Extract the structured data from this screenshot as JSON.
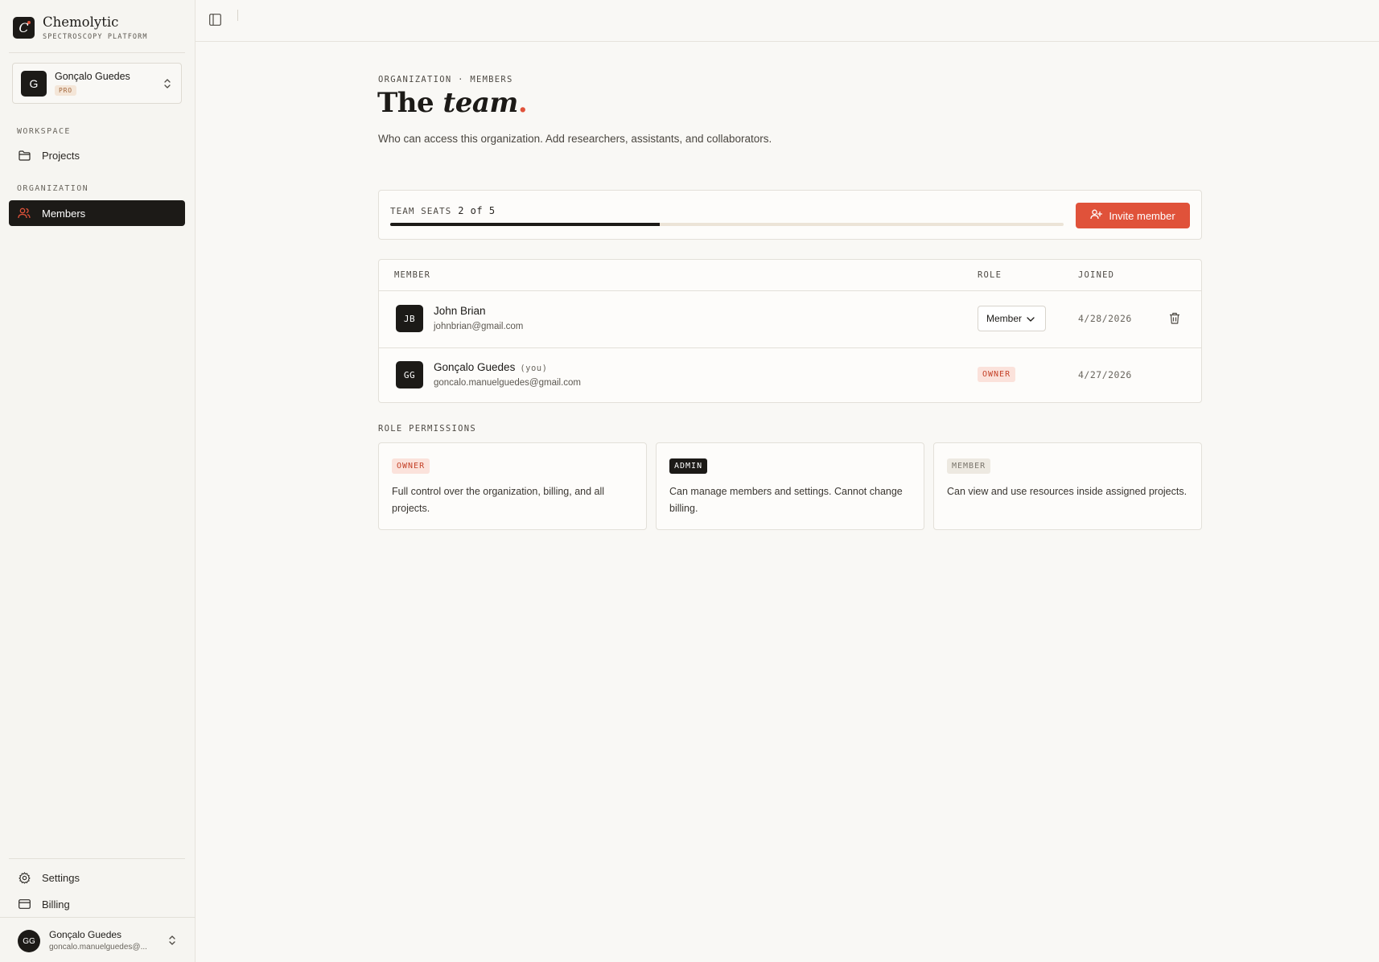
{
  "app": {
    "name": "Chemolytic",
    "subtitle": "SPECTROSCOPY PLATFORM",
    "logo_letter": "C"
  },
  "org_switcher": {
    "avatar_letter": "G",
    "name": "Gonçalo Guedes",
    "plan": "PRO"
  },
  "sidebar": {
    "workspace_label": "WORKSPACE",
    "organization_label": "ORGANIZATION",
    "projects_label": "Projects",
    "members_label": "Members",
    "settings_label": "Settings",
    "billing_label": "Billing"
  },
  "user_footer": {
    "initials": "GG",
    "name": "Gonçalo Guedes",
    "email": "goncalo.manuelguedes@..."
  },
  "page": {
    "eyebrow": "ORGANIZATION · MEMBERS",
    "title_plain": "The ",
    "title_italic": "team",
    "title_dot": ".",
    "description": "Who can access this organization. Add researchers, assistants, and collaborators."
  },
  "seats": {
    "label": "TEAM SEATS",
    "count_text": "2 of 5",
    "used": 2,
    "total": 5,
    "invite_label": "Invite member"
  },
  "table": {
    "headers": {
      "member": "MEMBER",
      "role": "ROLE",
      "joined": "JOINED"
    },
    "rows": [
      {
        "initials": "JB",
        "name": "John Brian",
        "email": "johnbrian@gmail.com",
        "role": "Member",
        "joined": "4/28/2026"
      },
      {
        "initials": "GG",
        "name": "Gonçalo Guedes",
        "you_tag": "(you)",
        "email": "goncalo.manuelguedes@gmail.com",
        "role": "OWNER",
        "joined": "4/27/2026"
      }
    ]
  },
  "permissions": {
    "label": "ROLE PERMISSIONS",
    "cards": [
      {
        "badge": "OWNER",
        "text": "Full control over the organization, billing, and all projects."
      },
      {
        "badge": "ADMIN",
        "text": "Can manage members and settings. Cannot change billing."
      },
      {
        "badge": "MEMBER",
        "text": "Can view and use resources inside assigned projects."
      }
    ]
  },
  "colors": {
    "accent": "#e0523a",
    "ink": "#1c1a17",
    "background": "#f9f8f5"
  },
  "icons": {
    "projects": "folder-icon",
    "members": "users-icon",
    "settings": "gear-icon",
    "billing": "credit-card-icon",
    "invite": "user-plus-icon",
    "delete": "trash-icon",
    "sidebar_toggle": "sidebar-toggle-icon"
  }
}
